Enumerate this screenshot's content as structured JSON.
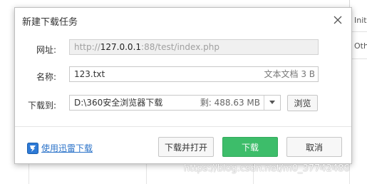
{
  "dialog": {
    "title": "新建下载任务",
    "url": {
      "label": "网址:",
      "scheme": "http://",
      "host": "127.0.0.1",
      "rest": ":88/test/index.php"
    },
    "name": {
      "label": "名称:",
      "value": "123.txt",
      "file_type": "文本文档 3 B"
    },
    "download_to": {
      "label": "下载到:",
      "path": "D:\\360安全浏览器下载",
      "free_space": "剩: 488.63 MB",
      "browse_label": "浏览"
    },
    "footer": {
      "thunder_link": "使用迅雷下载",
      "download_open_label": "下载并打开",
      "download_label": "下载",
      "cancel_label": "取消"
    }
  },
  "background": {
    "cell_1": "Initi",
    "cell_2": "Oth"
  },
  "watermark": "https://blog.csdn.net/m0_37742486",
  "colors": {
    "primary_button": "#3dbd6a",
    "link": "#2b73c9"
  }
}
